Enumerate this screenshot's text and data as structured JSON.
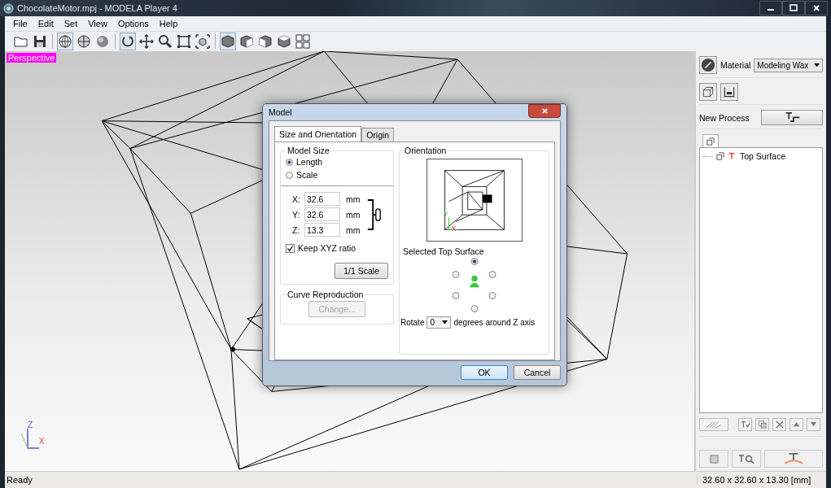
{
  "window": {
    "title": "ChocolateMotor.mpj - MODELA Player 4"
  },
  "menu": [
    "File",
    "Edit",
    "Set",
    "View",
    "Options",
    "Help"
  ],
  "toolbar": [
    {
      "kind": "open",
      "selected": false
    },
    {
      "kind": "save",
      "selected": false
    },
    {
      "kind": "wireframe",
      "selected": true
    },
    {
      "kind": "outline",
      "selected": false
    },
    {
      "kind": "shaded",
      "selected": false
    },
    {
      "kind": "rotate",
      "selected": true
    },
    {
      "kind": "pan",
      "selected": false
    },
    {
      "kind": "zoom",
      "selected": false
    },
    {
      "kind": "fit",
      "selected": false
    },
    {
      "kind": "fit-model",
      "selected": false
    },
    {
      "kind": "view-iso",
      "selected": true
    },
    {
      "kind": "view-front",
      "selected": false
    },
    {
      "kind": "view-right",
      "selected": false
    },
    {
      "kind": "view-top",
      "selected": false
    },
    {
      "kind": "view-multi",
      "selected": false
    }
  ],
  "viewport": {
    "label": "Perspective",
    "axis_z": "Z",
    "axis_x": "X"
  },
  "sidebar": {
    "material_label": "Material",
    "material": "Modeling Wax",
    "new_process_label": "New Process",
    "tree": [
      {
        "label": "Top Surface",
        "selected": false
      }
    ]
  },
  "dialog": {
    "title": "Model",
    "tabs": [
      {
        "label": "Size and Orientation",
        "selected": true
      },
      {
        "label": "Origin",
        "selected": false
      }
    ],
    "model_size": {
      "title": "Model Size",
      "modes": [
        {
          "label": "Length",
          "selected": true
        },
        {
          "label": "Scale",
          "selected": false
        }
      ],
      "fields": [
        {
          "label": "X:",
          "value": "32.6",
          "unit": "mm"
        },
        {
          "label": "Y:",
          "value": "32.6",
          "unit": "mm"
        },
        {
          "label": "Z:",
          "value": "13.3",
          "unit": "mm"
        }
      ],
      "keep_ratio": {
        "label": "Keep XYZ ratio",
        "checked": true
      },
      "scale_button": "1/1 Scale"
    },
    "curve": {
      "title": "Curve Reproduction",
      "button": {
        "label": "Change...",
        "disabled": true
      }
    },
    "orientation": {
      "title": "Orientation",
      "axis_y": "Y",
      "axis_x": "X",
      "surface_label": "Selected Top Surface",
      "surfaces": [
        {
          "selected": true
        },
        {
          "selected": false
        },
        {
          "selected": false
        },
        {
          "selected": false
        },
        {
          "selected": false
        },
        {
          "selected": false
        }
      ],
      "rotate_label": "Rotate",
      "rotate_value": "0",
      "rotate_suffix": "degrees around Z axis"
    },
    "buttons": [
      "OK",
      "Cancel"
    ]
  },
  "status_bar": {
    "left": "Ready",
    "right": "32.60 x 32.60 x 13.30 [mm]"
  }
}
